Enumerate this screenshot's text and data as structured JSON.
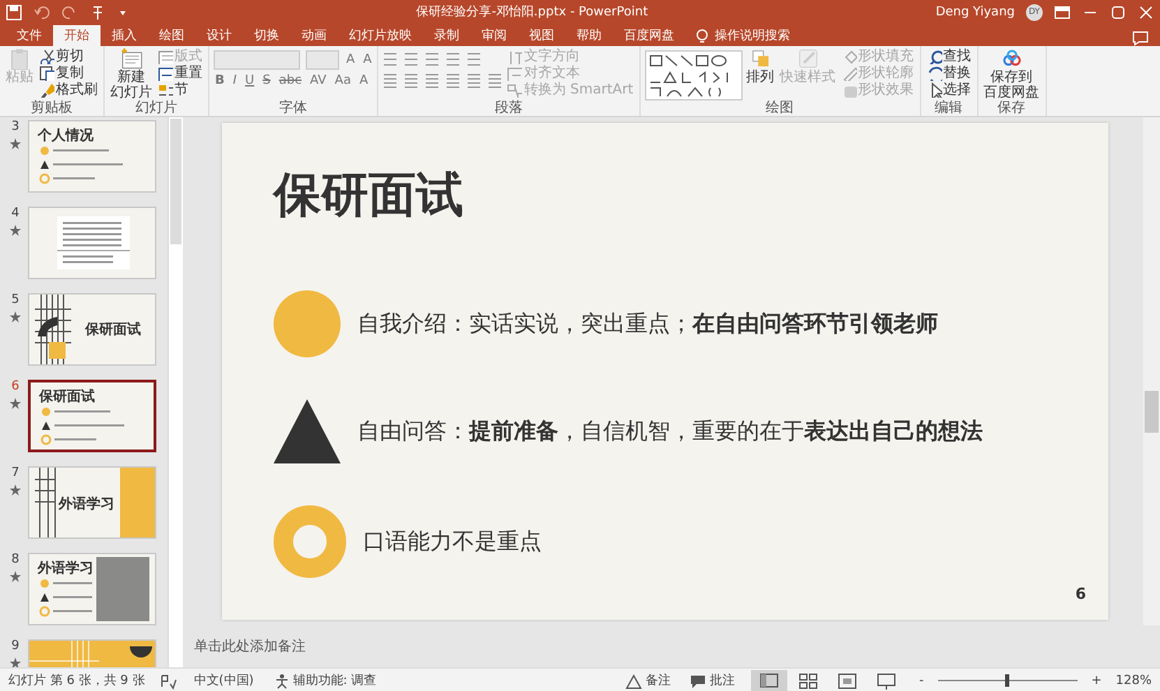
{
  "title_bar": {
    "file_title": "保研经验分享-邓怡阳.pptx  -  PowerPoint",
    "user": "Deng Yiyang",
    "avatar": "DY"
  },
  "tabs": [
    {
      "label": "文件",
      "selected": false
    },
    {
      "label": "开始",
      "selected": true
    },
    {
      "label": "插入",
      "selected": false
    },
    {
      "label": "绘图",
      "selected": false
    },
    {
      "label": "设计",
      "selected": false
    },
    {
      "label": "切换",
      "selected": false
    },
    {
      "label": "动画",
      "selected": false
    },
    {
      "label": "幻灯片放映",
      "selected": false
    },
    {
      "label": "录制",
      "selected": false
    },
    {
      "label": "审阅",
      "selected": false
    },
    {
      "label": "视图",
      "selected": false
    },
    {
      "label": "帮助",
      "selected": false
    },
    {
      "label": "百度网盘",
      "selected": false
    }
  ],
  "search": {
    "placeholder": "操作说明搜索"
  },
  "ribbon": [
    {
      "label": "剪贴板",
      "controls": [
        {
          "kind": "large",
          "label_lines": [
            "粘贴"
          ],
          "disabled": true
        },
        {
          "kind": "small",
          "label": "剪切",
          "disabled": false
        },
        {
          "kind": "small",
          "label": "复制",
          "disabled": false
        },
        {
          "kind": "small",
          "label": "格式刷",
          "disabled": false
        }
      ]
    },
    {
      "label": "幻灯片",
      "controls": [
        {
          "kind": "large",
          "label_lines": [
            "新建",
            "幻灯片"
          ],
          "disabled": false
        },
        {
          "kind": "small",
          "label": "版式",
          "disabled": true
        },
        {
          "kind": "small",
          "label": "重置",
          "disabled": false
        },
        {
          "kind": "small",
          "label": "节",
          "disabled": false
        }
      ]
    },
    {
      "label": "字体",
      "controls": [
        {
          "kind": "font-tools",
          "size_glyphs": [
            "A",
            "A"
          ],
          "glyphs": [
            "B",
            "I",
            "U",
            "S",
            "abc",
            "AV",
            "Aa",
            "A"
          ]
        }
      ]
    },
    {
      "label": "段落",
      "controls": [
        {
          "kind": "para-tools"
        },
        {
          "kind": "small",
          "label": "文字方向",
          "disabled": true
        },
        {
          "kind": "small",
          "label": "对齐文本",
          "disabled": true
        },
        {
          "kind": "small",
          "label": "转换为 SmartArt",
          "disabled": true
        }
      ]
    },
    {
      "label": "绘图",
      "controls": [
        {
          "kind": "gallery"
        },
        {
          "kind": "large",
          "label_lines": [
            "排列"
          ],
          "disabled": false
        },
        {
          "kind": "large",
          "label_lines": [
            "快速样式"
          ],
          "disabled": true
        },
        {
          "kind": "small",
          "label": "形状填充",
          "disabled": true
        },
        {
          "kind": "small",
          "label": "形状轮廓",
          "disabled": true
        },
        {
          "kind": "small",
          "label": "形状效果",
          "disabled": true
        }
      ]
    },
    {
      "label": "编辑",
      "controls": [
        {
          "kind": "small",
          "label": "查找",
          "disabled": false
        },
        {
          "kind": "small",
          "label": "替换",
          "disabled": false
        },
        {
          "kind": "small",
          "label": "选择",
          "disabled": false
        }
      ]
    },
    {
      "label": "保存",
      "controls": [
        {
          "kind": "large",
          "label_lines": [
            "保存到",
            "百度网盘"
          ],
          "disabled": false
        }
      ]
    }
  ],
  "thumbnails": [
    {
      "number": "3",
      "animated": true,
      "selected": false,
      "kind": "points",
      "title": "个人情况"
    },
    {
      "number": "4",
      "animated": true,
      "selected": false,
      "kind": "document"
    },
    {
      "number": "5",
      "animated": true,
      "selected": false,
      "kind": "grid-title",
      "title": "保研面试"
    },
    {
      "number": "6",
      "animated": true,
      "selected": true,
      "kind": "points",
      "title": "保研面试"
    },
    {
      "number": "7",
      "animated": true,
      "selected": false,
      "kind": "split",
      "title": "外语学习"
    },
    {
      "number": "8",
      "animated": true,
      "selected": false,
      "kind": "points-photo",
      "title": "外语学习"
    },
    {
      "number": "9",
      "animated": true,
      "selected": false,
      "kind": "pattern"
    }
  ],
  "slide": {
    "title": "保研面试",
    "points": [
      {
        "kind": "circle",
        "text": "自我介绍：实话实说，突出重点；**在自由问答环节引领老师**"
      },
      {
        "kind": "triangle",
        "text": "自由问答：**提前准备**，自信机智，重要的在于**表达出自己的想法**"
      },
      {
        "kind": "ring",
        "text": "口语能力不是重点"
      }
    ],
    "page_number": "6"
  },
  "notes": {
    "placeholder": "单击此处添加备注"
  },
  "status_bar": {
    "slide_info": "幻灯片 第 6 张，共 9 张",
    "language": "中文(中国)",
    "accessibility": "辅助功能: 调查",
    "notes_button": "备注",
    "comments_button": "批注",
    "views": [
      {
        "kind": "normal",
        "selected": true
      },
      {
        "kind": "sorter",
        "selected": false
      },
      {
        "kind": "reading",
        "selected": false
      },
      {
        "kind": "slideshow",
        "selected": false
      }
    ],
    "zoom_out": "-",
    "zoom_in": "+",
    "zoom": {
      "level": 0.5,
      "reading": "128%"
    }
  }
}
